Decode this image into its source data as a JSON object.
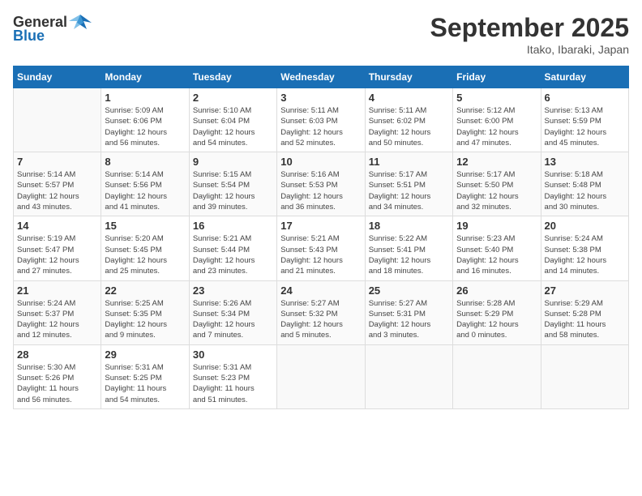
{
  "header": {
    "logo_general": "General",
    "logo_blue": "Blue",
    "month": "September 2025",
    "location": "Itako, Ibaraki, Japan"
  },
  "days_of_week": [
    "Sunday",
    "Monday",
    "Tuesday",
    "Wednesday",
    "Thursday",
    "Friday",
    "Saturday"
  ],
  "weeks": [
    [
      {
        "day": "",
        "info": ""
      },
      {
        "day": "1",
        "info": "Sunrise: 5:09 AM\nSunset: 6:06 PM\nDaylight: 12 hours\nand 56 minutes."
      },
      {
        "day": "2",
        "info": "Sunrise: 5:10 AM\nSunset: 6:04 PM\nDaylight: 12 hours\nand 54 minutes."
      },
      {
        "day": "3",
        "info": "Sunrise: 5:11 AM\nSunset: 6:03 PM\nDaylight: 12 hours\nand 52 minutes."
      },
      {
        "day": "4",
        "info": "Sunrise: 5:11 AM\nSunset: 6:02 PM\nDaylight: 12 hours\nand 50 minutes."
      },
      {
        "day": "5",
        "info": "Sunrise: 5:12 AM\nSunset: 6:00 PM\nDaylight: 12 hours\nand 47 minutes."
      },
      {
        "day": "6",
        "info": "Sunrise: 5:13 AM\nSunset: 5:59 PM\nDaylight: 12 hours\nand 45 minutes."
      }
    ],
    [
      {
        "day": "7",
        "info": "Sunrise: 5:14 AM\nSunset: 5:57 PM\nDaylight: 12 hours\nand 43 minutes."
      },
      {
        "day": "8",
        "info": "Sunrise: 5:14 AM\nSunset: 5:56 PM\nDaylight: 12 hours\nand 41 minutes."
      },
      {
        "day": "9",
        "info": "Sunrise: 5:15 AM\nSunset: 5:54 PM\nDaylight: 12 hours\nand 39 minutes."
      },
      {
        "day": "10",
        "info": "Sunrise: 5:16 AM\nSunset: 5:53 PM\nDaylight: 12 hours\nand 36 minutes."
      },
      {
        "day": "11",
        "info": "Sunrise: 5:17 AM\nSunset: 5:51 PM\nDaylight: 12 hours\nand 34 minutes."
      },
      {
        "day": "12",
        "info": "Sunrise: 5:17 AM\nSunset: 5:50 PM\nDaylight: 12 hours\nand 32 minutes."
      },
      {
        "day": "13",
        "info": "Sunrise: 5:18 AM\nSunset: 5:48 PM\nDaylight: 12 hours\nand 30 minutes."
      }
    ],
    [
      {
        "day": "14",
        "info": "Sunrise: 5:19 AM\nSunset: 5:47 PM\nDaylight: 12 hours\nand 27 minutes."
      },
      {
        "day": "15",
        "info": "Sunrise: 5:20 AM\nSunset: 5:45 PM\nDaylight: 12 hours\nand 25 minutes."
      },
      {
        "day": "16",
        "info": "Sunrise: 5:21 AM\nSunset: 5:44 PM\nDaylight: 12 hours\nand 23 minutes."
      },
      {
        "day": "17",
        "info": "Sunrise: 5:21 AM\nSunset: 5:43 PM\nDaylight: 12 hours\nand 21 minutes."
      },
      {
        "day": "18",
        "info": "Sunrise: 5:22 AM\nSunset: 5:41 PM\nDaylight: 12 hours\nand 18 minutes."
      },
      {
        "day": "19",
        "info": "Sunrise: 5:23 AM\nSunset: 5:40 PM\nDaylight: 12 hours\nand 16 minutes."
      },
      {
        "day": "20",
        "info": "Sunrise: 5:24 AM\nSunset: 5:38 PM\nDaylight: 12 hours\nand 14 minutes."
      }
    ],
    [
      {
        "day": "21",
        "info": "Sunrise: 5:24 AM\nSunset: 5:37 PM\nDaylight: 12 hours\nand 12 minutes."
      },
      {
        "day": "22",
        "info": "Sunrise: 5:25 AM\nSunset: 5:35 PM\nDaylight: 12 hours\nand 9 minutes."
      },
      {
        "day": "23",
        "info": "Sunrise: 5:26 AM\nSunset: 5:34 PM\nDaylight: 12 hours\nand 7 minutes."
      },
      {
        "day": "24",
        "info": "Sunrise: 5:27 AM\nSunset: 5:32 PM\nDaylight: 12 hours\nand 5 minutes."
      },
      {
        "day": "25",
        "info": "Sunrise: 5:27 AM\nSunset: 5:31 PM\nDaylight: 12 hours\nand 3 minutes."
      },
      {
        "day": "26",
        "info": "Sunrise: 5:28 AM\nSunset: 5:29 PM\nDaylight: 12 hours\nand 0 minutes."
      },
      {
        "day": "27",
        "info": "Sunrise: 5:29 AM\nSunset: 5:28 PM\nDaylight: 11 hours\nand 58 minutes."
      }
    ],
    [
      {
        "day": "28",
        "info": "Sunrise: 5:30 AM\nSunset: 5:26 PM\nDaylight: 11 hours\nand 56 minutes."
      },
      {
        "day": "29",
        "info": "Sunrise: 5:31 AM\nSunset: 5:25 PM\nDaylight: 11 hours\nand 54 minutes."
      },
      {
        "day": "30",
        "info": "Sunrise: 5:31 AM\nSunset: 5:23 PM\nDaylight: 11 hours\nand 51 minutes."
      },
      {
        "day": "",
        "info": ""
      },
      {
        "day": "",
        "info": ""
      },
      {
        "day": "",
        "info": ""
      },
      {
        "day": "",
        "info": ""
      }
    ]
  ]
}
